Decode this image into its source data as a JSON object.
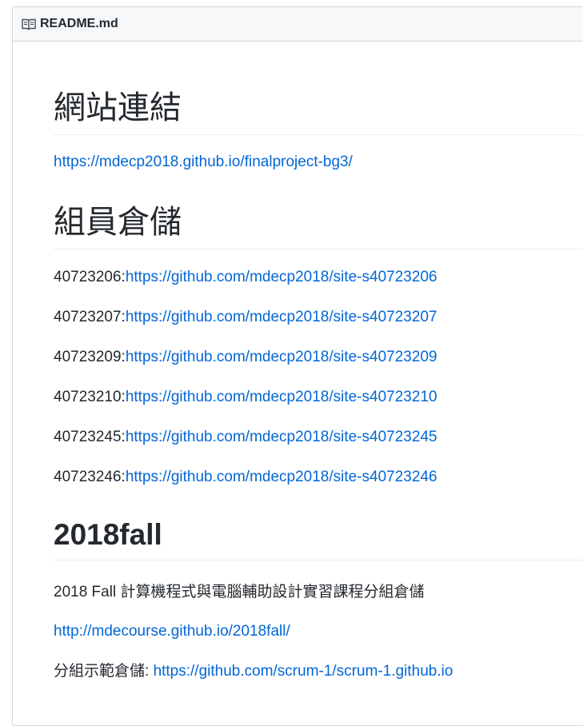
{
  "readme": {
    "filename": "README.md",
    "icon": "book-icon"
  },
  "sections": {
    "website": {
      "heading": "網站連結",
      "link": "https://mdecp2018.github.io/finalproject-bg3/"
    },
    "members": {
      "heading": "組員倉儲",
      "items": [
        {
          "id": "40723206:",
          "url": "https://github.com/mdecp2018/site-s40723206"
        },
        {
          "id": "40723207:",
          "url": "https://github.com/mdecp2018/site-s40723207"
        },
        {
          "id": "40723209:",
          "url": "https://github.com/mdecp2018/site-s40723209"
        },
        {
          "id": "40723210:",
          "url": "https://github.com/mdecp2018/site-s40723210"
        },
        {
          "id": "40723245:",
          "url": "https://github.com/mdecp2018/site-s40723245"
        },
        {
          "id": "40723246:",
          "url": "https://github.com/mdecp2018/site-s40723246"
        }
      ]
    },
    "fall": {
      "heading": "2018fall",
      "description": "2018 Fall 計算機程式與電腦輔助設計實習課程分組倉儲",
      "course_link": "http://mdecourse.github.io/2018fall/",
      "example_label": "分組示範倉儲: ",
      "example_link": "https://github.com/scrum-1/scrum-1.github.io"
    }
  }
}
